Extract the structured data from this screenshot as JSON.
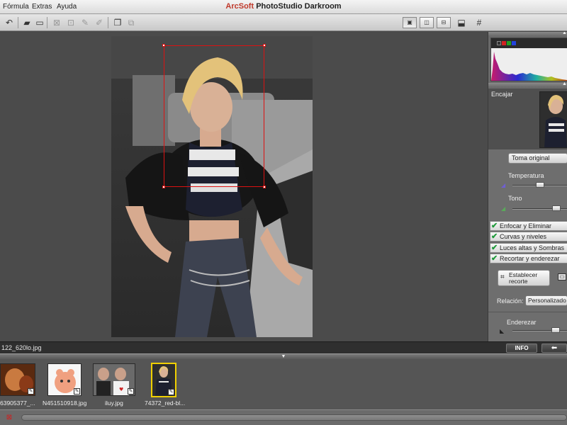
{
  "menu": {
    "items": [
      "Fórmula",
      "Extras",
      "Ayuda"
    ],
    "title_brand": "ArcSoft",
    "title_product": "PhotoStudio Darkroom"
  },
  "toolbar": {
    "icons": [
      "undo-icon",
      "save-icon",
      "save-as-icon",
      "crop-icon",
      "straighten-icon",
      "red-eye-icon",
      "brush-icon",
      "duplicate-icon",
      "share-icon",
      "view-single-icon",
      "view-compare-icon",
      "view-compare-alt-icon",
      "stamp-icon",
      "grid-icon"
    ]
  },
  "status": {
    "filename": "122_620lo.jpg",
    "info_label": "INFO",
    "back_label": "⬅"
  },
  "filmstrip": {
    "items": [
      {
        "label": "63905377_...",
        "selected": false
      },
      {
        "label": "N451510918.jpg",
        "selected": false
      },
      {
        "label": "iluy.jpg",
        "selected": false
      },
      {
        "label": "74372_red-bl...",
        "selected": true
      }
    ]
  },
  "panel": {
    "histogram": {
      "channels": [
        "#333333",
        "#d22222",
        "#22a022",
        "#2244dd"
      ]
    },
    "preview": {
      "label": "Encajar"
    },
    "adjust": {
      "preset_label": "Toma original",
      "temperature_label": "Temperatura",
      "temperature_value": 0.5,
      "tone_label": "Tono",
      "tone_value": 0.85
    },
    "sections": [
      "Enfocar y Eliminar ruido",
      "Curvas y niveles",
      "Luces altas y Sombras",
      "Recortar y enderezar"
    ],
    "crop": {
      "set_crop_label": "Establecer recorte",
      "ratio_label": "Relación:",
      "ratio_value": "Personalizado",
      "straighten_label": "Enderezar",
      "straighten_value": 0.83
    }
  }
}
